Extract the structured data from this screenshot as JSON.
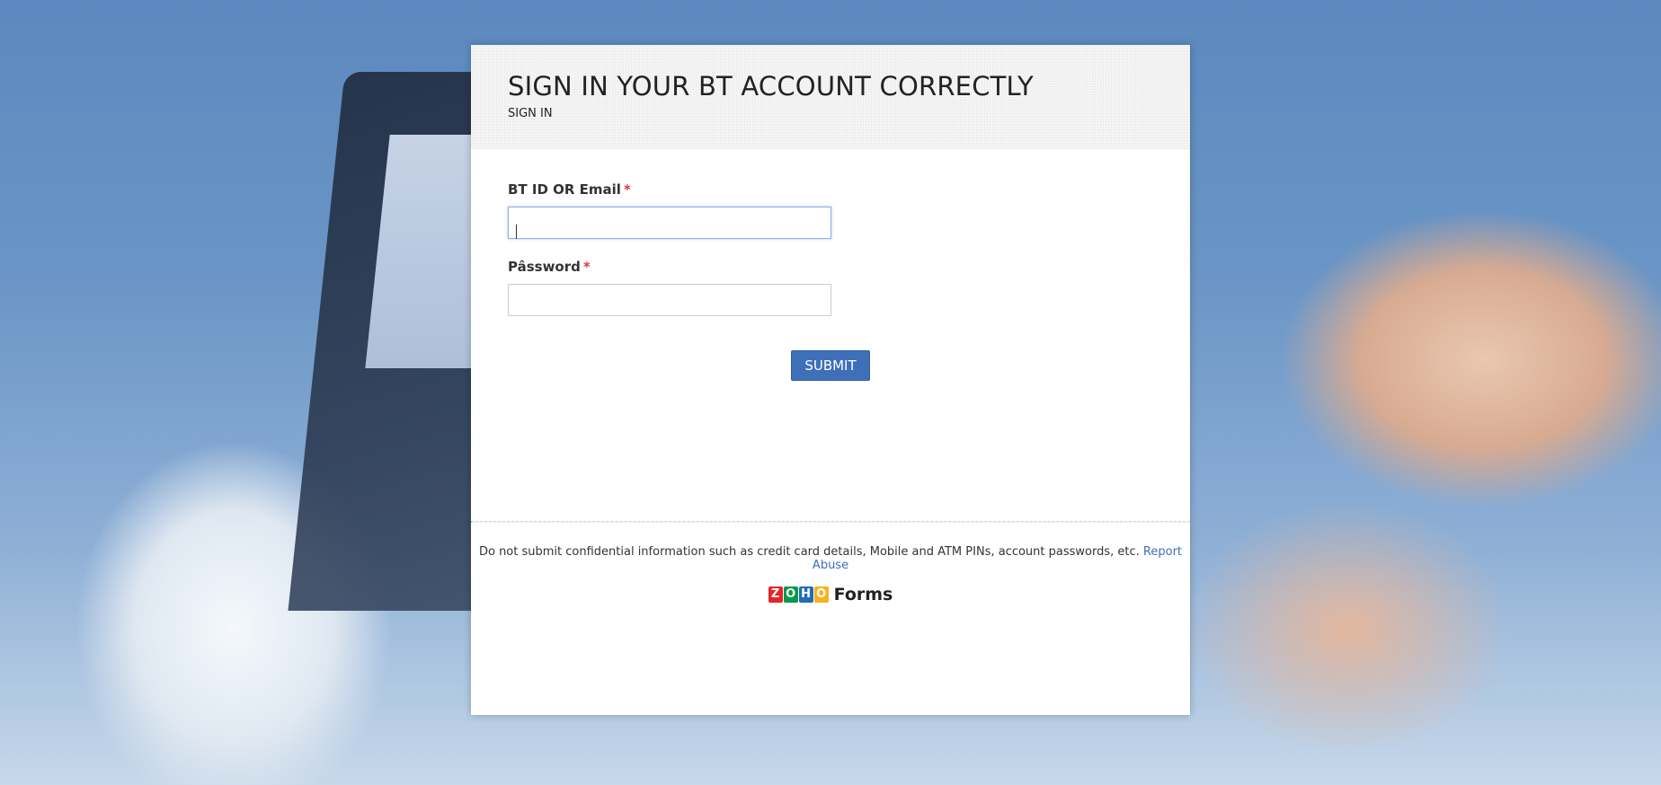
{
  "form": {
    "title": "SIGN IN YOUR BT ACCOUNT CORRECTLY",
    "subtitle": "SIGN IN",
    "fields": {
      "email": {
        "label": "BT ID OR Email",
        "required_mark": "*",
        "value": ""
      },
      "password": {
        "label": "Pâssword",
        "required_mark": "*",
        "value": ""
      }
    },
    "submit_label": "SUBMIT"
  },
  "footer": {
    "disclaimer": "Do not submit confidential information such as credit card details, Mobile and ATM PINs, account passwords, etc.",
    "report_link": "Report Abuse",
    "brand": {
      "logo_letters": [
        "Z",
        "O",
        "H",
        "O"
      ],
      "logo_colors": [
        "#e42527",
        "#089949",
        "#226db4",
        "#f9b21d"
      ],
      "text": "Forms"
    }
  },
  "colors": {
    "accent": "#3e6fb9",
    "required": "#e53935"
  }
}
